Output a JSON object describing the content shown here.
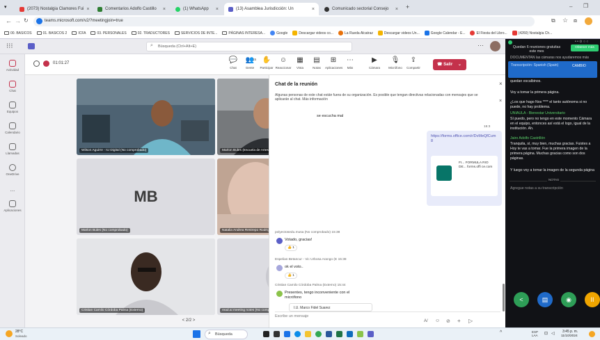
{
  "browser": {
    "tabs": [
      {
        "label": "(2073) Nostalgia Clamores Fui",
        "color": "#e53935"
      },
      {
        "label": "Comentarios Adolfo Castillo",
        "color": "#2e7d32"
      },
      {
        "label": "(1) WhatsApp",
        "color": "#25d366"
      },
      {
        "label": "(13) Asamblea Jurisdicción: Un",
        "color": "#5b5fc7"
      },
      {
        "label": "Comunicado sectorial Consejo",
        "color": "#333333"
      }
    ],
    "new_tab": "+",
    "url": "teams.microsoft.com/v2/?meetingjoin=true",
    "bookmarks": [
      "00. BASICOS",
      "01. BASICOS 2",
      "ICFA",
      "03. PERSONALES",
      "02. TRADUCTORES",
      "SERVICIOS DE INTE...",
      "PÁGINAS INTERESA...",
      "Google",
      "Descargar videos co...",
      "La Rueda Alcatraz",
      "Descargar videos Un...",
      "Google Calendar - E...",
      "El Fiesta del Libro...",
      "(4260) Nostalgia Ch..."
    ]
  },
  "teams": {
    "search_placeholder": "Búsqueda (Ctrl+Alt+E)",
    "rail": [
      {
        "label": "Actividad",
        "icon": "bell-icon"
      },
      {
        "label": "Chat",
        "icon": "chat-icon"
      },
      {
        "label": "Equipos",
        "icon": "teams-icon"
      },
      {
        "label": "Calendario",
        "icon": "calendar-icon"
      },
      {
        "label": "Llamadas",
        "icon": "phone-icon"
      },
      {
        "label": "OneDrive",
        "icon": "cloud-icon"
      },
      {
        "label": "...",
        "icon": "more-icon"
      },
      {
        "label": "Aplicaciones",
        "icon": "apps-icon"
      }
    ],
    "meeting_timer": "01:01:27",
    "controls": [
      {
        "label": "Chat",
        "glyph": "💬"
      },
      {
        "label": "Gente",
        "glyph": "👥"
      },
      {
        "label": "Participar",
        "glyph": "✋"
      },
      {
        "label": "Reaccionar",
        "glyph": "☺"
      },
      {
        "label": "Vista",
        "glyph": "▦"
      },
      {
        "label": "Notas",
        "glyph": "▤"
      },
      {
        "label": "Aplicaciones",
        "glyph": "⊞"
      },
      {
        "label": "Más",
        "glyph": "⋯"
      },
      {
        "label": "Cámara",
        "glyph": "▶"
      },
      {
        "label": "Micrófono",
        "glyph": "🎙"
      },
      {
        "label": "Compartir",
        "glyph": "⇪"
      }
    ],
    "people_count": "15",
    "leave_label": "Salir",
    "participants": [
      {
        "name": "Wilson Aguirre - IU Digital (No comprobado)",
        "initials": "",
        "bg": "#3f5a6b"
      },
      {
        "name": "Marlon Bules (Escuela de Artes) (Externo)",
        "initials": "",
        "bg": "#6b6e72"
      },
      {
        "name": "Marlon Bules (No comprobado)",
        "initials": "MB",
        "bg": "#d6d6db"
      },
      {
        "name": "Natalia Andrea Restrepo Rodríguez - Arte y Cultura (No comprobado)",
        "initials": "",
        "bg": "#c9a98e"
      },
      {
        "name": "Cristian Camilo Córdoba Palma (Externo)",
        "initials": "",
        "bg": "#4b3b32"
      },
      {
        "name": "read.ai meeting notes (No comprobado)",
        "initials": "RN",
        "bg": "#d6d6db"
      }
    ],
    "pager": "< 2/2 >"
  },
  "chat": {
    "title": "Chat de la reunión",
    "notice": "Algunas personas de este chat están fuera de su organización. Es posible que tengan directivas relacionadas con mensajes que se aplicarán al chat. Más información",
    "partial": "se escucha mal",
    "link_time": "15:3",
    "link_text": "https://forms.office.com/r/DvMeQfCum8",
    "card_title": "FI...  FORMULA RIO DE... forms.offi ce.com",
    "messages": [
      {
        "meta": "polyectosedu.musa (No comprobado)  15:38",
        "text": "Votado, gracias!",
        "reaction": "👍 1"
      },
      {
        "meta": "Espelian Betancur - Vic Urbosa Arango (E  15:38",
        "text": "ok el voto..",
        "reaction": "👍 1"
      },
      {
        "meta": "Cristian Camilo Córdoba Palma (Externo)  15:44",
        "text": "Presentes, tengo inconveniente con el micrófono",
        "reaction": ""
      }
    ],
    "quoted": "I.U. Marco Fidel Suarez",
    "compose_placeholder": "Escribe un mensaje"
  },
  "captions": {
    "banner": "Quedan 6 reuniones gratuitas este mes",
    "banner_cta": "Obtener más",
    "topline": "DOCUMENTAN las cámaras nos ayudaremos más",
    "source": "Transcripción: Spanish (Spain)",
    "lang": "CAMBIO",
    "lines": [
      {
        "speaker": "",
        "text": "quedan escalbinos."
      },
      {
        "speaker": "",
        "text": "Voy a tomar la primera página."
      },
      {
        "speaker": "",
        "text": "¿Los que hago Nos **** el tanto autónoma si no puede, no hay problema."
      },
      {
        "speaker": "UNIAULA - Bienestar Universitario",
        "text": "Sí puedo, pero no tengo en este momento Cámara en el equipo, entonces así está el logo, igual de la institución. Ah."
      },
      {
        "speaker": "Jairo Adolfo Castrillón",
        "text": "Tranquila, sí, muy bien, muchas gracias. Fuistes a Hoy te vas a tomar. Fue la primera imagen de la primera página. Muchas gracias como son dos páginas."
      },
      {
        "speaker": "",
        "text": "Y luego voy a tomar la imagen de la segunda página"
      }
    ],
    "notes_label": "NOTAS",
    "notes_placeholder": "Agregue notas a su transcripción"
  },
  "taskbar": {
    "weather": "28°C",
    "weather_sub": "Soleado",
    "search": "Búsqueda",
    "lang": "ESP LAA",
    "time": "3:45 p. m.",
    "date": "11/10/2024"
  }
}
